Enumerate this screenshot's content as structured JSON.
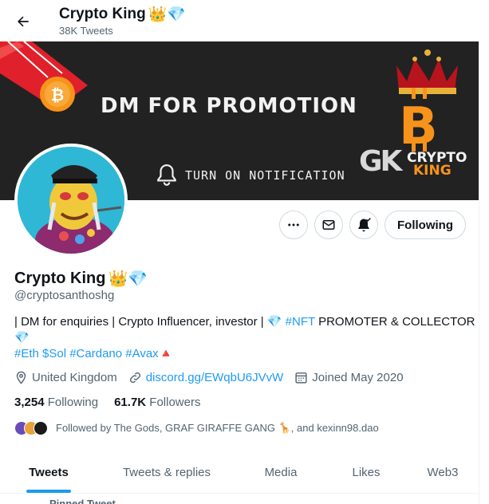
{
  "header": {
    "title": "Crypto King",
    "title_emoji": "👑💎",
    "subtitle": "38K Tweets"
  },
  "banner": {
    "promo_text": "DM FOR PROMOTION",
    "notify_text": "TURN ON NOTIFICATION",
    "logo_mark": "GK",
    "logo_line1": "CRYPTO",
    "logo_line2": "KING"
  },
  "actions": {
    "following_label": "Following"
  },
  "profile": {
    "name": "Crypto King",
    "name_emoji": "👑💎",
    "handle": "@cryptosanthoshg",
    "bio_part1": "| DM for enquiries | Crypto Influencer, investor | 💎 ",
    "bio_link_nft": "#NFT",
    "bio_part2": " PROMOTER & COLLECTOR 💎",
    "bio_tags": "#Eth $Sol #Cardano #Avax",
    "bio_end_emoji": "🔺",
    "location": "United Kingdom",
    "website": "discord.gg/EWqbU6JVvW",
    "joined": "Joined May 2020"
  },
  "stats": {
    "following_count": "3,254",
    "following_label": "Following",
    "followers_count": "61.7K",
    "followers_label": "Followers"
  },
  "followed_by": "Followed by The Gods, GRAF GIRAFFE GANG 🦒, and kexinn98.dao",
  "tabs": [
    {
      "label": "Tweets",
      "active": true
    },
    {
      "label": "Tweets & replies",
      "active": false
    },
    {
      "label": "Media",
      "active": false
    },
    {
      "label": "Likes",
      "active": false
    },
    {
      "label": "Web3",
      "active": false
    }
  ],
  "pinned_label": "Pinned Tweet",
  "colors": {
    "accent": "#1d9bf0",
    "text": "#0f1419",
    "muted": "#536471",
    "banner_bg": "#222222",
    "bitcoin_orange": "#f7931a"
  }
}
